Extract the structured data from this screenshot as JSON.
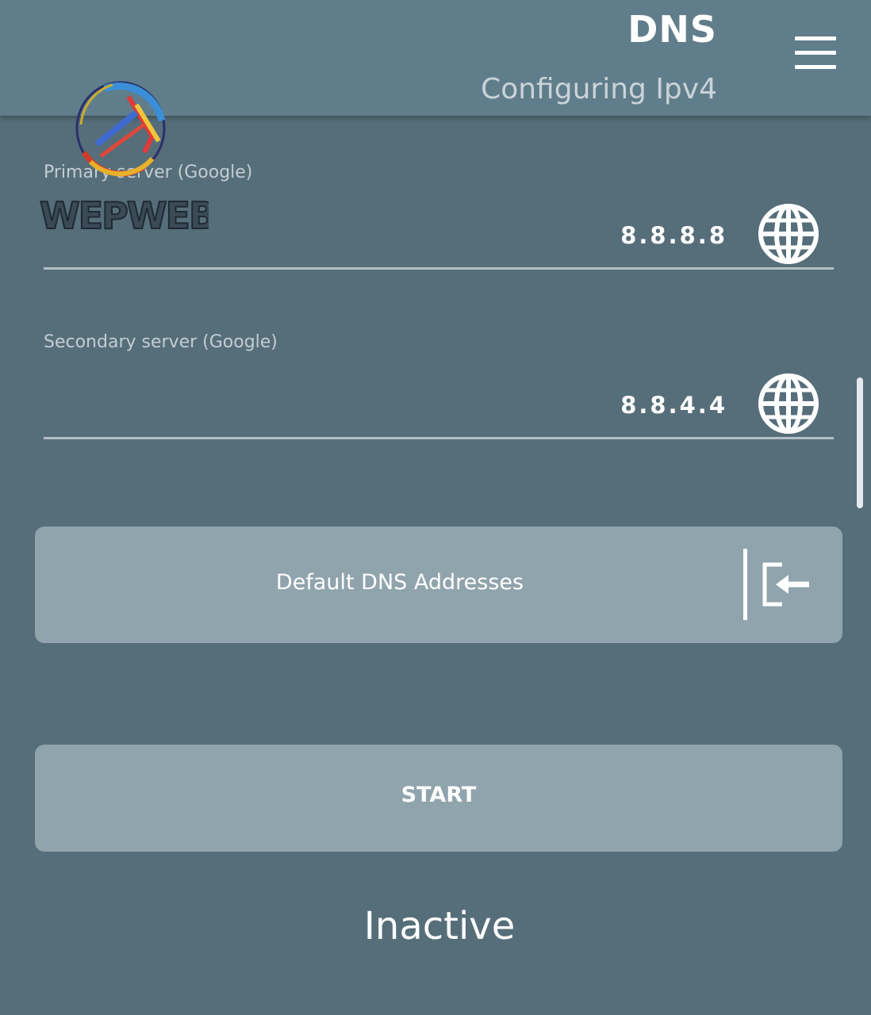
{
  "header": {
    "title": "DNS",
    "subtitle": "Configuring Ipv4",
    "menu_icon": "hamburger-menu-icon"
  },
  "watermark": {
    "text": "WEPWEB",
    "icon": "wepweb-globe-logo"
  },
  "fields": [
    {
      "label": "Primary server (Google)",
      "value": "8.8.8.8",
      "icon": "globe-icon"
    },
    {
      "label": "Secondary server (Google)",
      "value": "8.8.4.4",
      "icon": "globe-icon"
    }
  ],
  "default_button": {
    "label": "Default DNS Addresses",
    "icon": "import-icon"
  },
  "start_button": {
    "label": "START"
  },
  "status": {
    "text": "Inactive"
  },
  "colors": {
    "app_bar": "#607d8b",
    "background": "#566e7a",
    "button": "#90a4ad",
    "text": "#ffffff"
  }
}
